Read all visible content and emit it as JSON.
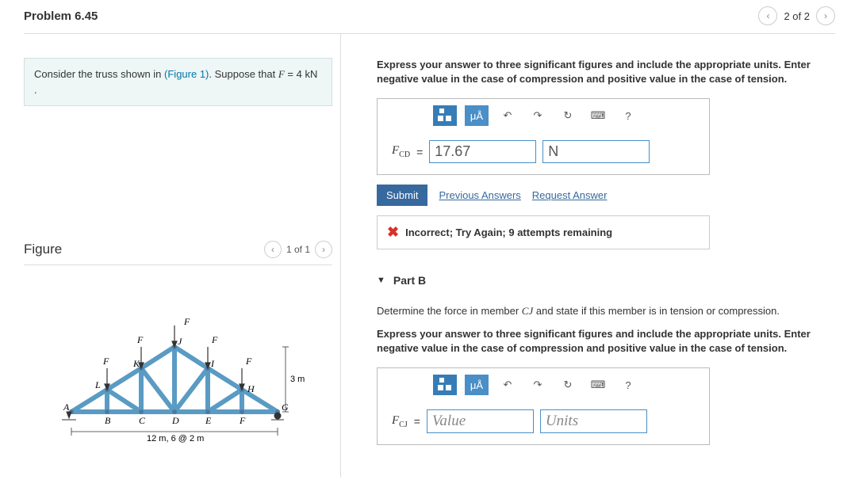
{
  "header": {
    "title": "Problem 6.45",
    "page_label": "2 of 2"
  },
  "prompt": {
    "pre": "Consider the truss shown in ",
    "link": "(Figure 1)",
    "post": ". Suppose that ",
    "var": "F",
    "eq": " = 4  kN ."
  },
  "figure": {
    "title": "Figure",
    "page_label": "1 of 1",
    "dim_h": "3 m",
    "dim_w": "12 m, 6 @ 2 m",
    "labels_top": [
      "F",
      "F",
      "F",
      "F",
      "F"
    ],
    "labels_joint": [
      "L",
      "K",
      "J",
      "I",
      "H"
    ],
    "labels_bot": [
      "A",
      "B",
      "C",
      "D",
      "E",
      "F",
      "G"
    ]
  },
  "partA": {
    "instruction": "Express your answer to three significant figures and include the appropriate units. Enter negative value in the case of compression and positive value in the case of tension.",
    "var_html": "F<sub>CD</sub>",
    "value": "17.67",
    "unit": "N",
    "submit": "Submit",
    "prev_ans": "Previous Answers",
    "req_ans": "Request Answer",
    "feedback": "Incorrect; Try Again; 9 attempts remaining"
  },
  "partB": {
    "title": "Part B",
    "prompt_pre": "Determine the force in member ",
    "prompt_var": "CJ",
    "prompt_post": " and state if this member is in tension or compression.",
    "instruction": "Express your answer to three significant figures and include the appropriate units. Enter negative value in the case of compression and positive value in the case of tension.",
    "var_html": "F<sub>CJ</sub>",
    "value_ph": "Value",
    "unit_ph": "Units"
  },
  "toolbar": {
    "mu": "μÅ",
    "undo": "↶",
    "redo": "↷",
    "reset": "↻",
    "kbd": "⌨",
    "help": "?"
  }
}
